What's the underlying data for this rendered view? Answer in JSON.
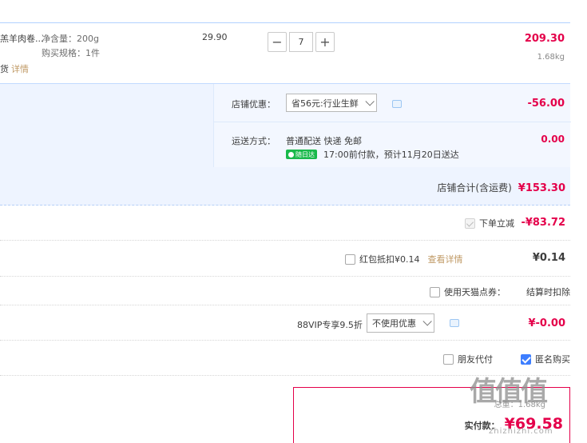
{
  "product": {
    "name": "羔羊肉卷...",
    "attr_net": "净含量：200g",
    "attr_spec": "购买规格：1件",
    "foot_prefix": "货",
    "foot_detail": "详情",
    "unit_price": "29.90",
    "qty": "7",
    "qty_minus": "−",
    "qty_plus": "+",
    "subtotal": "209.30",
    "weight": "1.68kg"
  },
  "shop": {
    "discount_label": "店铺优惠：",
    "discount_select": "省56元:行业生鲜",
    "discount_value": "-56.00",
    "shipping_label": "运送方式：",
    "shipping_method": "普通配送 快递 免邮",
    "shipping_badge": "随日达",
    "shipping_eta": "17:00前付款，预计11月20日送达",
    "shipping_value": "0.00",
    "total_label": "店铺合计(含运费)",
    "total_value": "¥153.30"
  },
  "order": {
    "instant_discount_label": "下单立减",
    "instant_discount_value": "-¥83.72",
    "redpacket_label": "红包抵扣¥0.14",
    "redpacket_detail": "查看详情",
    "redpacket_value": "¥0.14",
    "coupon_label": "使用天猫点券：",
    "coupon_value": "结算时扣除",
    "vip_label": "88VIP专享9.5折",
    "vip_select": "不使用优惠",
    "vip_value": "¥-0.00",
    "friend_pay_label": "朋友代付",
    "anonymous_label": "匿名购买"
  },
  "summary": {
    "weight_text": "总重：1.68kg",
    "pay_label": "实付款：",
    "pay_value": "¥69.58"
  },
  "watermark": {
    "logo": "值值值",
    "url": "zhizhizhi.com"
  },
  "colors": {
    "accent_red": "#e4004a",
    "shop_bg": "#eef4ff",
    "checkbox_blue": "#3d7eff",
    "link_brown": "#c09a66",
    "badge_green": "#19b94b"
  }
}
